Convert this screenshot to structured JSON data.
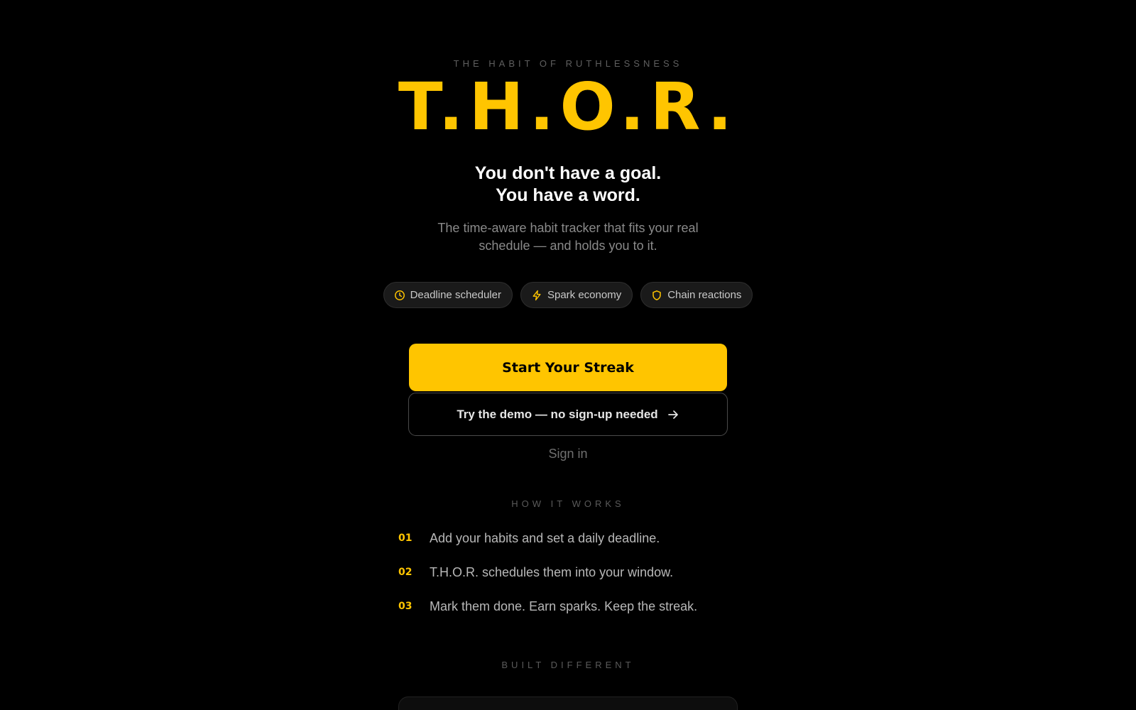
{
  "hero": {
    "eyebrow": "THE HABIT OF RUTHLESSNESS",
    "logo": "T.H.O.R.",
    "headline_line1": "You don't have a goal.",
    "headline_line2": "You have a word.",
    "subtext": "The time-aware habit tracker that fits your real schedule — and holds you to it."
  },
  "features": [
    {
      "label": "Deadline scheduler",
      "icon": "clock-icon"
    },
    {
      "label": "Spark economy",
      "icon": "lightning-icon"
    },
    {
      "label": "Chain reactions",
      "icon": "shield-icon"
    }
  ],
  "cta": {
    "primary_label": "Start Your Streak",
    "secondary_label": "Try the demo — no sign-up needed",
    "secondary_icon": "arrow-right-icon",
    "signin_label": "Sign in"
  },
  "how_it_works": {
    "title": "HOW IT WORKS",
    "steps": [
      {
        "num": "01",
        "text": "Add your habits and set a daily deadline."
      },
      {
        "num": "02",
        "text": "T.H.O.R. schedules them into your window."
      },
      {
        "num": "03",
        "text": "Mark them done. Earn sparks. Keep the streak."
      }
    ]
  },
  "built_different": {
    "title": "BUILT DIFFERENT"
  },
  "colors": {
    "background": "#000000",
    "accent": "#ffc500",
    "pill_bg": "#1a1a1a",
    "muted_text": "#8a8a8a"
  }
}
